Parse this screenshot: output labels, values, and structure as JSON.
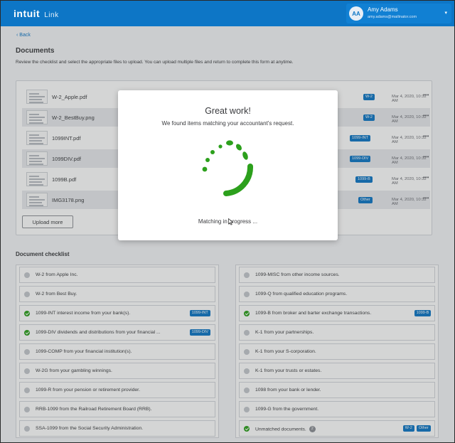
{
  "header": {
    "brand": "intuit",
    "product": "Link",
    "user": {
      "initials": "AA",
      "name": "Amy Adams",
      "email": "amy.adams@mailinator.com"
    }
  },
  "nav": {
    "back_label": "Back"
  },
  "documents": {
    "title": "Documents",
    "description": "Review the checklist and select the appropriate files to upload. You can upload multiple files and return to complete this form at anytime.",
    "upload_label": "Upload more",
    "files": [
      {
        "name": "W-2_Apple.pdf",
        "tag": "W-2",
        "date": "Mar 4, 2020, 10:32 AM"
      },
      {
        "name": "W-2_BestBuy.png",
        "tag": "W-2",
        "date": "Mar 4, 2020, 10:32 AM"
      },
      {
        "name": "1099INT.pdf",
        "tag": "1099-INT",
        "date": "Mar 4, 2020, 10:32 AM"
      },
      {
        "name": "1099DIV.pdf",
        "tag": "1099-DIV",
        "date": "Mar 4, 2020, 10:32 AM"
      },
      {
        "name": "1099B.pdf",
        "tag": "1099-B",
        "date": "Mar 4, 2020, 10:32 AM"
      },
      {
        "name": "IMG3178.png",
        "tag": "Other",
        "date": "Mar 4, 2020, 10:32 AM"
      }
    ]
  },
  "checklist": {
    "title": "Document checklist",
    "left": [
      {
        "text": "W-2 from Apple Inc.",
        "done": false,
        "tags": []
      },
      {
        "text": "W-2 from Best Buy.",
        "done": false,
        "tags": []
      },
      {
        "text": "1099-INT interest income from your bank(s).",
        "done": true,
        "tags": [
          "1099-INT"
        ]
      },
      {
        "text": "1099-DIV dividends and distributions from your financial ...",
        "done": true,
        "tags": [
          "1099-DIV"
        ]
      },
      {
        "text": "1099-COMP from your financial institution(s).",
        "done": false,
        "tags": []
      },
      {
        "text": "W-2G from your gambling winnings.",
        "done": false,
        "tags": []
      },
      {
        "text": "1099-R from your pension or retirement provider.",
        "done": false,
        "tags": []
      },
      {
        "text": "RRB-1099 from the Railroad Retirement Board (RRB).",
        "done": false,
        "tags": []
      },
      {
        "text": "SSA-1099 from the Social Security Administration.",
        "done": false,
        "tags": []
      }
    ],
    "right": [
      {
        "text": "1099-MISC from other income sources.",
        "done": false,
        "tags": []
      },
      {
        "text": "1099-Q from qualified education programs.",
        "done": false,
        "tags": []
      },
      {
        "text": "1099-B from broker and barter exchange transactions.",
        "done": true,
        "tags": [
          "1099-B"
        ]
      },
      {
        "text": "K-1 from your partnerships.",
        "done": false,
        "tags": []
      },
      {
        "text": "K-1 from your S-corporation.",
        "done": false,
        "tags": []
      },
      {
        "text": "K-1 from your trusts or estates.",
        "done": false,
        "tags": []
      },
      {
        "text": "1098 from your bank or lender.",
        "done": false,
        "tags": []
      },
      {
        "text": "1099-G from the government.",
        "done": false,
        "tags": []
      },
      {
        "text": "Unmatched documents.",
        "done": true,
        "count": "2",
        "tags": [
          "W-2",
          "Other"
        ]
      }
    ]
  },
  "modal": {
    "title": "Great work!",
    "subtitle": "We found items matching your accountant's request.",
    "status": "Matching in progress ..."
  },
  "colors": {
    "brand": "#0d76c6",
    "success": "#2ca01c"
  },
  "icons": {
    "more": "more-icon",
    "caret": "chevron-down-icon",
    "back": "chevron-left-icon"
  }
}
